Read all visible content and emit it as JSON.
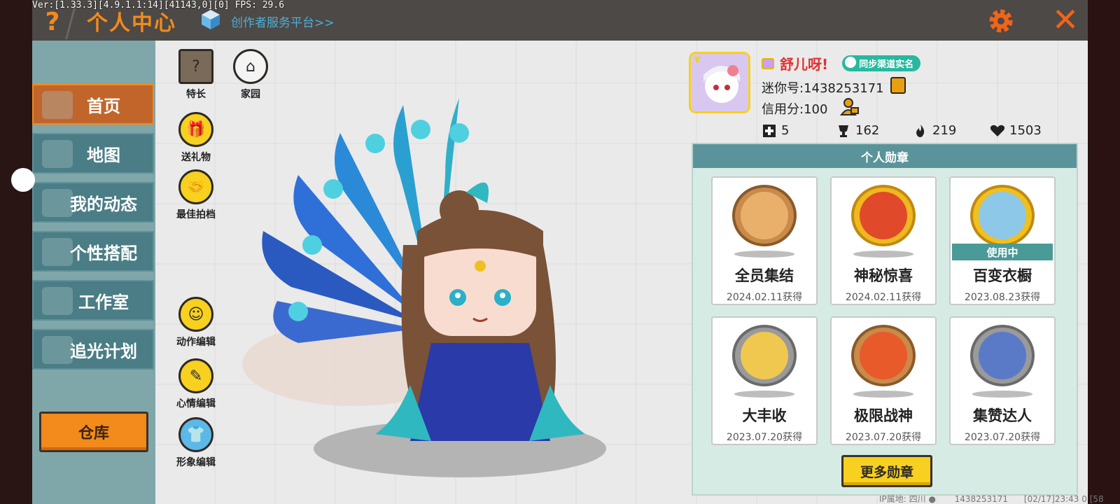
{
  "debug": {
    "text": "Ver:[1.33.3][4.9.1.1:14][41143,0][0] FPS: 29.6"
  },
  "header": {
    "help_glyph": "?",
    "title": "个人中心",
    "creator_link": "创作者服务平台>>",
    "close_glyph": "✕"
  },
  "sidebar": {
    "items": [
      {
        "label": "首页",
        "active": true
      },
      {
        "label": "地图",
        "active": false
      },
      {
        "label": "我的动态",
        "active": false
      },
      {
        "label": "个性搭配",
        "active": false
      },
      {
        "label": "工作室",
        "active": false
      },
      {
        "label": "追光计划",
        "active": false
      }
    ],
    "warehouse_label": "仓库"
  },
  "tools": {
    "talent": {
      "label": "特长",
      "glyph": "?"
    },
    "home": {
      "label": "家园",
      "glyph": "⌂"
    },
    "gift": {
      "label": "送礼物",
      "glyph": "🎁"
    },
    "partner": {
      "label": "最佳拍档",
      "glyph": "🤝"
    },
    "action_edit": {
      "label": "动作编辑",
      "glyph": "☺"
    },
    "mood_edit": {
      "label": "心情编辑",
      "glyph": "✎"
    },
    "image_edit": {
      "label": "形象编辑",
      "glyph": "👕"
    }
  },
  "profile": {
    "username": "舒儿呀!",
    "sync_label": "同步渠道实名",
    "mini_id": "迷你号:1438253171",
    "credit": "信用分:100",
    "stats": [
      {
        "icon": "plus-square-icon",
        "value": "5"
      },
      {
        "icon": "trophy-icon",
        "value": "162"
      },
      {
        "icon": "flame-icon",
        "value": "219"
      },
      {
        "icon": "heart-icon",
        "value": "1503"
      }
    ]
  },
  "badges": {
    "title": "个人勋章",
    "items": [
      {
        "name": "全员集结",
        "date": "2024.02.11获得",
        "ring": "#c98a4a",
        "inner": "#e8b06a",
        "in_use": false
      },
      {
        "name": "神秘惊喜",
        "date": "2024.02.11获得",
        "ring": "#f0b820",
        "inner": "#e04a2a",
        "in_use": false
      },
      {
        "name": "百变衣橱",
        "date": "2023.08.23获得",
        "ring": "#f0c020",
        "inner": "#8ec8e8",
        "in_use": true
      },
      {
        "name": "大丰收",
        "date": "2023.07.20获得",
        "ring": "#9a9a9a",
        "inner": "#f0c850",
        "in_use": false
      },
      {
        "name": "极限战神",
        "date": "2023.07.20获得",
        "ring": "#c98a4a",
        "inner": "#e85a2a",
        "in_use": false
      },
      {
        "name": "集赞达人",
        "date": "2023.07.20获得",
        "ring": "#9a9a9a",
        "inner": "#5a7ac8",
        "in_use": false
      }
    ],
    "in_use_label": "使用中",
    "more_label": "更多勋章"
  },
  "footer": {
    "ip": "IP属地: 四川",
    "uid": "1438253171",
    "time": "[02/17]23:43",
    "extra": "0   [58"
  },
  "colors": {
    "accent": "#f28a1c",
    "sidebar_item": "#4a7d85",
    "badge_header": "#5a949a",
    "name": "#e03030"
  }
}
